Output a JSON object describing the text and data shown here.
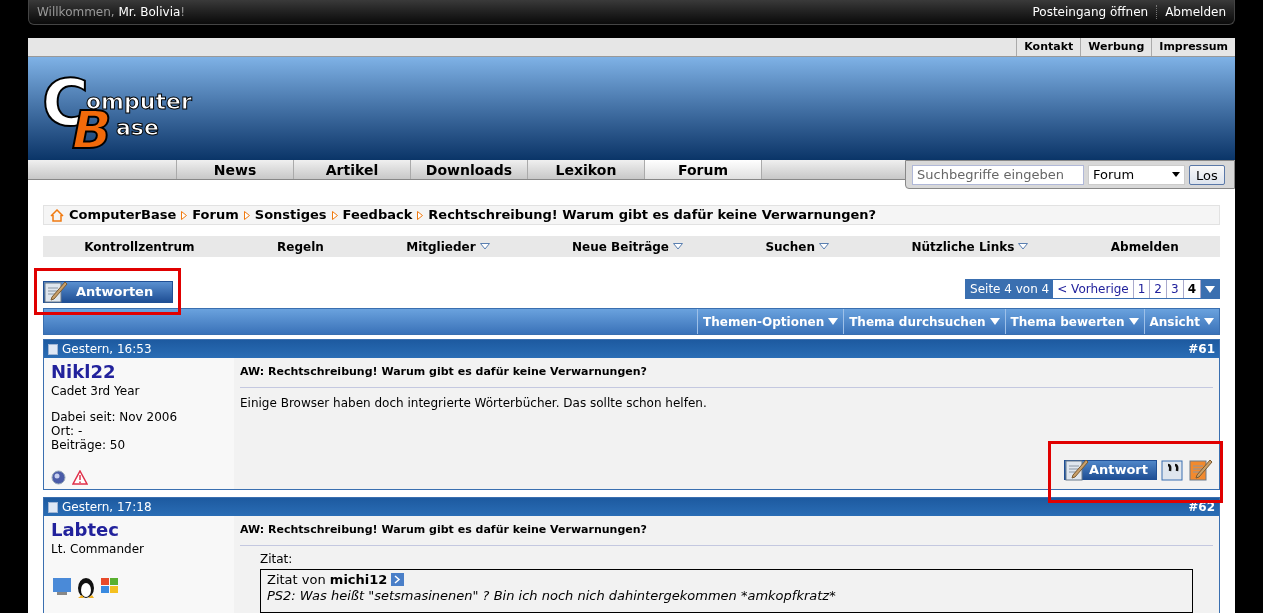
{
  "top_bar": {
    "welcome": [
      "Willkommen, ",
      "Mr. Bolivia",
      "!"
    ],
    "links": [
      "Posteingang öffnen",
      "Abmelden"
    ]
  },
  "util_links": [
    "Kontakt",
    "Werbung",
    "Impressum"
  ],
  "logo": [
    "C",
    "omputer",
    "B",
    "ase"
  ],
  "nav_tabs": [
    {
      "label": "News",
      "selected": false
    },
    {
      "label": "Artikel",
      "selected": false
    },
    {
      "label": "Downloads",
      "selected": false
    },
    {
      "label": "Lexikon",
      "selected": false
    },
    {
      "label": "Forum",
      "selected": true
    }
  ],
  "search": {
    "placeholder": "Suchbegriffe eingeben",
    "scope": "Forum",
    "button": "Los"
  },
  "breadcrumb": [
    "ComputerBase",
    "Forum",
    "Sonstiges",
    "Feedback",
    "Rechtschreibung! Warum gibt es dafür keine Verwarnungen?"
  ],
  "sub_nav": [
    {
      "label": "Kontrollzentrum",
      "has_menu": false
    },
    {
      "label": "Regeln",
      "has_menu": false
    },
    {
      "label": "Mitglieder",
      "has_menu": true
    },
    {
      "label": "Neue Beiträge",
      "has_menu": true
    },
    {
      "label": "Suchen",
      "has_menu": true
    },
    {
      "label": "Nützliche Links",
      "has_menu": true
    },
    {
      "label": "Abmelden",
      "has_menu": false
    }
  ],
  "reply_button": "Antworten",
  "pagination": {
    "label": "Seite 4 von 4",
    "prev": "< Vorherige",
    "pages": [
      {
        "label": "1",
        "selected": false
      },
      {
        "label": "2",
        "selected": false
      },
      {
        "label": "3",
        "selected": false
      },
      {
        "label": "4",
        "selected": true
      }
    ]
  },
  "thread_tools": [
    "Themen-Optionen",
    "Thema durchsuchen",
    "Thema bewerten",
    "Ansicht"
  ],
  "posts": [
    {
      "date": "Gestern, 16:53",
      "number": "#61",
      "author": "Nikl22",
      "rank": "Cadet 3rd Year",
      "info": [
        "Dabei seit: Nov 2006",
        "Ort: -",
        "Beiträge: 50"
      ],
      "title": "AW: Rechtschreibung! Warum gibt es dafür keine Verwarnungen?",
      "text": "Einige Browser haben doch integrierte Wörterbücher. Das sollte schon helfen.",
      "reply_button": "Antwort",
      "kind": "text"
    },
    {
      "date": "Gestern, 17:18",
      "number": "#62",
      "author": "Labtec",
      "rank": "Lt. Commander",
      "title": "AW: Rechtschreibung! Warum gibt es dafür keine Verwarnungen?",
      "quote_label": "Zitat:",
      "quote_head": "Zitat von **michi12**",
      "quote_text": "PS2: Was heißt \"setsmasinenen\" ? Bin ich noch nich dahintergekommen *amkopfkratz*",
      "kind": "quote"
    }
  ]
}
